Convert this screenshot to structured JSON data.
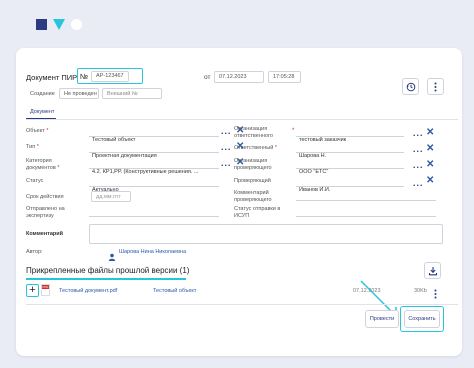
{
  "document": {
    "title_prefix": "Документ ПИР",
    "number_sign": "№",
    "number_value": "АР-123467",
    "from_label": "от",
    "date": "07.12.2023",
    "time": "17:05:28"
  },
  "filters": {
    "created": "Создание",
    "not_posted": "Не проведен",
    "external_placeholder": "Внешний №"
  },
  "tabs": {
    "document": "Документ"
  },
  "fields": {
    "object_label": "Объект",
    "object_value": "Тестовый объект",
    "type_label": "Тип",
    "type_value": "Проектная документация",
    "category_label": "Категория документов",
    "category_value": "4.2. КР1,РР. (Конструктивные решения. ...",
    "status_label": "Статус",
    "status_value": "Актуально",
    "deadline_label": "Срок действия",
    "deadline_placeholder": "дд.мм.гггг",
    "sent_label": "Отправлено на экспертизу",
    "resp_org_label": "Организация ответственного",
    "resp_org_value": "тестовый заказчик",
    "responsible_label": "Ответственный",
    "responsible_value": "Шарова Н.",
    "checker_org_label": "Организация проверяющего",
    "checker_org_value": "ООО \"ЕТС\"",
    "checker_label": "Проверяющий",
    "checker_value": "Иванов И.И.",
    "checker_comment_label": "Комментарий проверяющего",
    "send_status_label": "Статус отправки в ИСУП",
    "comment_label": "Комментарий",
    "author_label": "Автор:",
    "author_value": "Шарова Нина Николаевна"
  },
  "files": {
    "section_title": "Прикрепленные файлы прошлой версии (1)",
    "file_badge": "PDF",
    "file_name": "Тестовый документ.pdf",
    "file_object": "Тестовый объект",
    "file_date": "07.12.2023",
    "file_size": "30Kb"
  },
  "actions": {
    "post": "Провести",
    "save": "Сохранить"
  },
  "colors": {
    "accent": "#26c6da",
    "brand": "#2b3a82",
    "link": "#2b5aa8"
  }
}
